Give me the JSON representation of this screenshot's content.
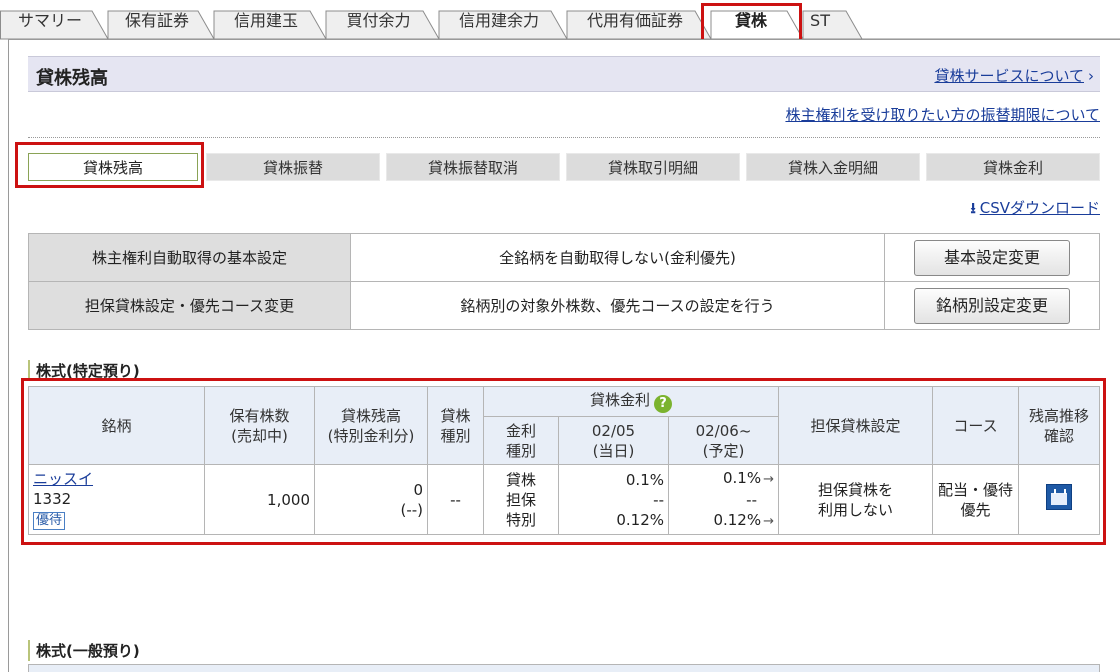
{
  "tabs": [
    {
      "label": "サマリー"
    },
    {
      "label": "保有証券"
    },
    {
      "label": "信用建玉"
    },
    {
      "label": "買付余力"
    },
    {
      "label": "信用建余力"
    },
    {
      "label": "代用有価証券"
    },
    {
      "label": "貸株",
      "active": true
    },
    {
      "label": "ST"
    }
  ],
  "header": {
    "title": "貸株残高",
    "service_link": "貸株サービスについて"
  },
  "rights_link": "株主権利を受け取りたい方の振替期限について",
  "subtabs": [
    {
      "label": "貸株残高",
      "active": true
    },
    {
      "label": "貸株振替"
    },
    {
      "label": "貸株振替取消"
    },
    {
      "label": "貸株取引明細"
    },
    {
      "label": "貸株入金明細"
    },
    {
      "label": "貸株金利"
    }
  ],
  "csv_link": "CSVダウンロード",
  "settings": [
    {
      "label": "株主権利自動取得の基本設定",
      "value": "全銘柄を自動取得しない(金利優先)",
      "button": "基本設定変更"
    },
    {
      "label": "担保貸株設定・優先コース変更",
      "value": "銘柄別の対象外株数、優先コースの設定を行う",
      "button": "銘柄別設定変更"
    }
  ],
  "section_specific": "株式(特定預り)",
  "section_general": "株式(一般預り)",
  "table": {
    "headers": {
      "stock": "銘柄",
      "shares": "保有株数",
      "shares_sub": "(売却中)",
      "balance": "貸株残高",
      "balance_sub": "(特別金利分)",
      "type": "貸株",
      "type_sub": "種別",
      "rate": "貸株金利",
      "rate_help": "?",
      "rate_kind": "金利",
      "rate_kind_sub": "種別",
      "date_today": "02/05",
      "date_today_sub": "(当日)",
      "date_next": "02/06~",
      "date_next_sub": "(予定)",
      "collateral": "担保貸株設定",
      "course": "コース",
      "history": "残高推移",
      "history_sub": "確認"
    },
    "row": {
      "name": "ニッスイ",
      "code": "1332",
      "badge": "優待",
      "shares": "1,000",
      "balance": "0",
      "balance_sub": "(--)",
      "type": "--",
      "kinds": [
        "貸株",
        "担保",
        "特別"
      ],
      "today": [
        "0.1%",
        "--",
        "0.12%"
      ],
      "next": [
        "0.1%",
        "--",
        "0.12%"
      ],
      "next_arrow": "→",
      "collateral": "担保貸株を",
      "collateral_sub": "利用しない",
      "course": "配当・優待",
      "course_sub": "優先"
    }
  }
}
